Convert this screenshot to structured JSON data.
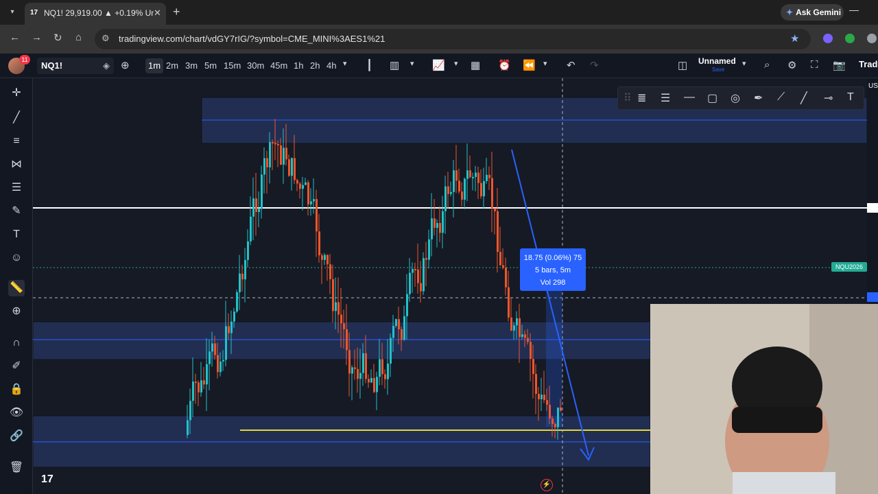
{
  "browser": {
    "tab_title": "NQ1! 29,919.00 ▲ +0.19% Unn",
    "url": "tradingview.com/chart/vdGY7rIG/?symbol=CME_MINI%3AES1%21",
    "gemini_label": "Ask Gemini"
  },
  "toolbar": {
    "notification_count": "11",
    "symbol": "NQ1!",
    "intervals": [
      "1m",
      "2m",
      "3m",
      "5m",
      "15m",
      "30m",
      "45m",
      "1h",
      "2h",
      "4h"
    ],
    "active_interval": "1m",
    "layout_name": "Unnamed",
    "layout_save": "Save",
    "trade_label": "Trad"
  },
  "chart": {
    "measure_line1": "18.75 (0.06%) 75",
    "measure_line2": "5 bars, 5m",
    "measure_line3": "Vol 298",
    "price_tag": "NQU2026",
    "axis_top_label": "US",
    "accent": "#2962ff",
    "up_color": "#22c3c9",
    "down_color": "#f0562b"
  }
}
